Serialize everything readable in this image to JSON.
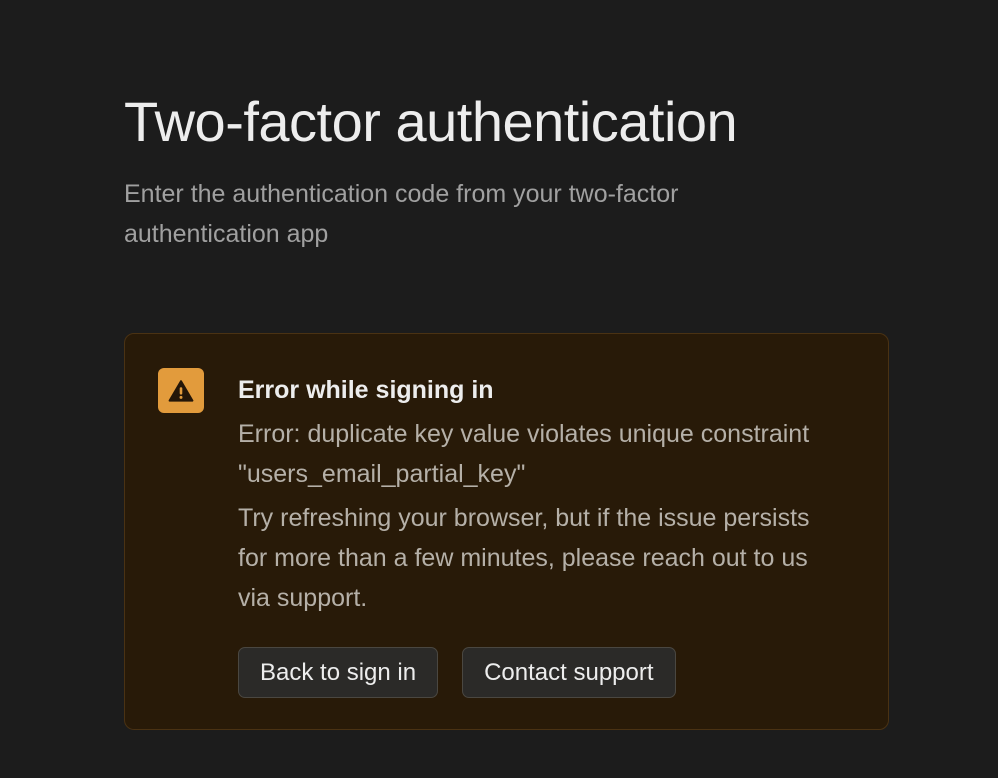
{
  "header": {
    "title": "Two-factor authentication",
    "subtitle": "Enter the authentication code from your two-factor authentication app"
  },
  "alert": {
    "icon": "warning-icon",
    "accent_color": "#e29b3c",
    "background_color": "#281a08",
    "title": "Error while signing in",
    "message": "Error: duplicate key value violates unique constraint \"users_email_partial_key\"",
    "hint": "Try refreshing your browser, but if the issue persists for more than a few minutes, please reach out to us via support."
  },
  "actions": {
    "back_label": "Back to sign in",
    "support_label": "Contact support"
  }
}
